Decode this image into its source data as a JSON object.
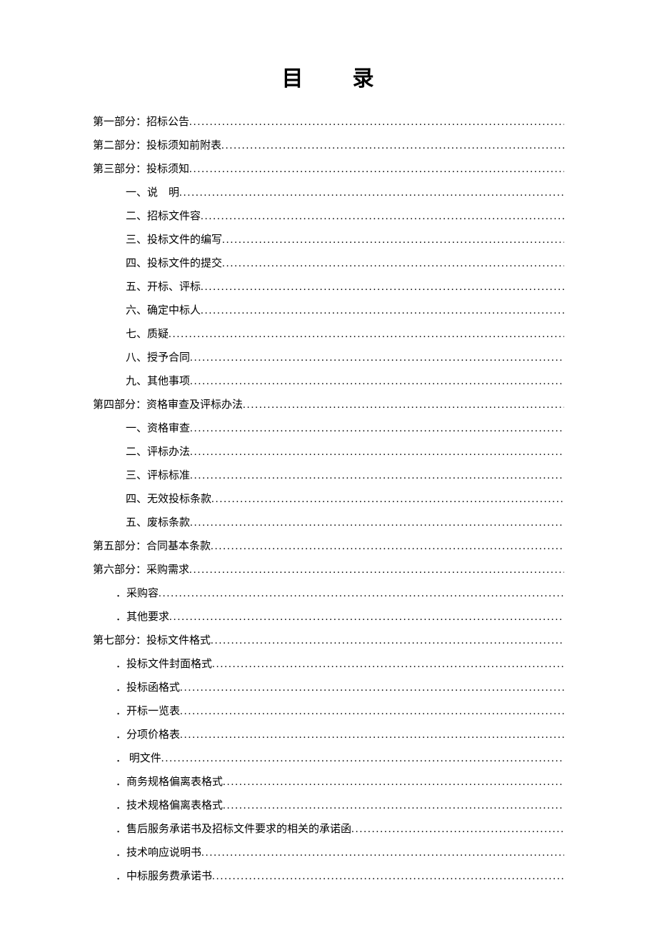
{
  "title_part1": "目",
  "title_part2": "录",
  "toc": [
    {
      "text": "第一部分：招标公告",
      "indent": 1
    },
    {
      "text": "第二部分：投标须知前附表",
      "indent": 1
    },
    {
      "text": "第三部分：投标须知",
      "indent": 1
    },
    {
      "text": "一、说　明",
      "indent": 2
    },
    {
      "text": "二、招标文件容",
      "indent": 2
    },
    {
      "text": "三、投标文件的编写",
      "indent": 2
    },
    {
      "text": "四、投标文件的提交",
      "indent": 2
    },
    {
      "text": "五、开标、评标",
      "indent": 2
    },
    {
      "text": "六、确定中标人",
      "indent": 2
    },
    {
      "text": "七、质疑",
      "indent": 2
    },
    {
      "text": "八、授予合同",
      "indent": 2
    },
    {
      "text": "九、其他事项",
      "indent": 2
    },
    {
      "text": "第四部分：资格审查及评标办法",
      "indent": 1
    },
    {
      "text": "一、资格审查",
      "indent": 2
    },
    {
      "text": "二、评标办法",
      "indent": 2
    },
    {
      "text": "三、评标标准",
      "indent": 2
    },
    {
      "text": "四、无效投标条款",
      "indent": 2
    },
    {
      "text": "五、废标条款",
      "indent": 2
    },
    {
      "text": "第五部分：合同基本条款",
      "indent": 1
    },
    {
      "text": "第六部分：采购需求",
      "indent": 1
    },
    {
      "text": "．采购容",
      "indent": 3
    },
    {
      "text": "．其他要求",
      "indent": 3
    },
    {
      "text": "第七部分：投标文件格式",
      "indent": 1
    },
    {
      "text": "．投标文件封面格式",
      "indent": 3
    },
    {
      "text": "．投标函格式",
      "indent": 3
    },
    {
      "text": "．开标一览表",
      "indent": 3
    },
    {
      "text": "．分项价格表",
      "indent": 3
    },
    {
      "text": "．  明文件",
      "indent": 3
    },
    {
      "text": "．商务规格偏离表格式",
      "indent": 3
    },
    {
      "text": "．技术规格偏离表格式",
      "indent": 3
    },
    {
      "text": "．售后服务承诺书及招标文件要求的相关的承诺函",
      "indent": 3
    },
    {
      "text": "．技术响应说明书",
      "indent": 3
    },
    {
      "text": "．中标服务费承诺书",
      "indent": 3
    }
  ]
}
